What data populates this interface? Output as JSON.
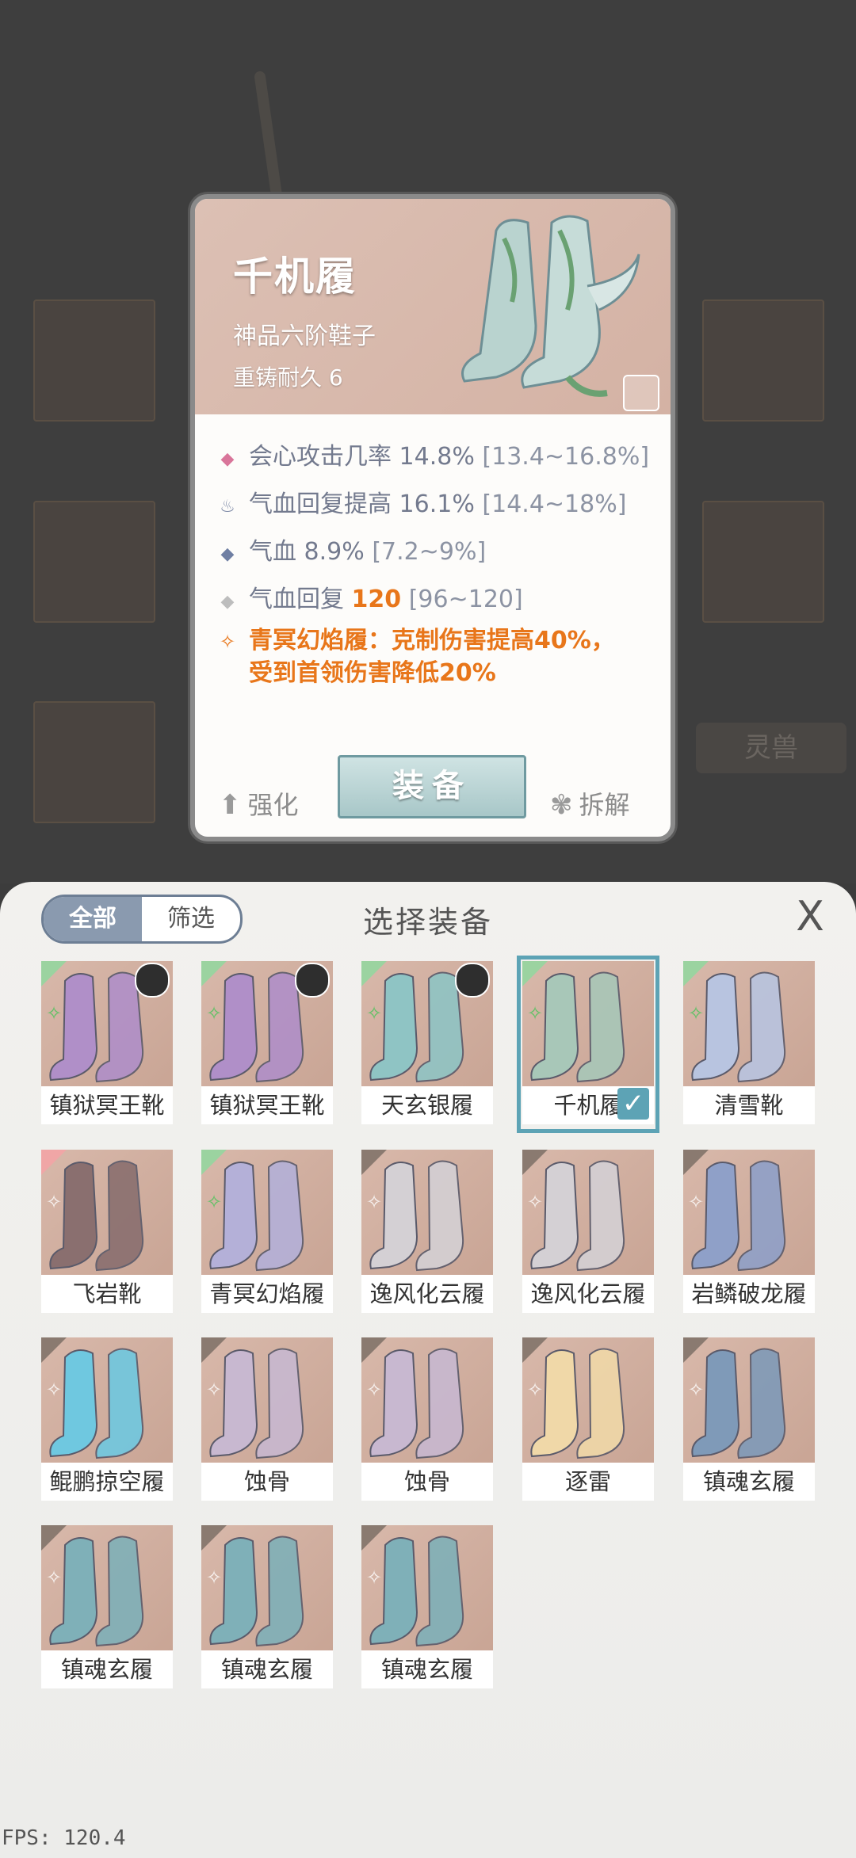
{
  "detail": {
    "name": "千机履",
    "subtitle": "神品六阶鞋子",
    "durability": "重铸耐久 6",
    "stats": [
      {
        "icon": "crit-diamond-icon",
        "glyph": "◆",
        "color": "#d9759a",
        "label": "会心攻击几率",
        "value": "14.8%",
        "range": "[13.4~16.8%]",
        "highlight": false
      },
      {
        "icon": "hp-regen-flame-icon",
        "glyph": "♨",
        "color": "#7b87a5",
        "label": "气血回复提高",
        "value": "16.1%",
        "range": "[14.4~18%]",
        "highlight": false
      },
      {
        "icon": "hp-diamond-icon",
        "glyph": "◆",
        "color": "#6f7fa3",
        "label": "气血",
        "value": "8.9%",
        "range": "[7.2~9%]",
        "highlight": false
      },
      {
        "icon": "hp-regen-diamond-icon",
        "glyph": "◆",
        "color": "#bdbdbd",
        "label": "气血回复",
        "value": "120",
        "range": "[96~120]",
        "highlight": true
      }
    ],
    "special": {
      "line1": "青冥幻焰履：克制伤害提高40%，",
      "line2": "受到首领伤害降低20%"
    },
    "actions": {
      "enhance": "强化",
      "equip": "装备",
      "disassemble": "拆解"
    }
  },
  "background": {
    "tag": "灵兽"
  },
  "panel": {
    "title": "选择装备",
    "tab_all": "全部",
    "tab_filter": "筛选",
    "close": "X",
    "items": [
      {
        "name": "镇狱冥王靴",
        "tone": "#b08fc8",
        "owner": true,
        "mark": "green"
      },
      {
        "name": "镇狱冥王靴",
        "tone": "#b08fc8",
        "owner": true,
        "mark": "green"
      },
      {
        "name": "天玄银履",
        "tone": "#8fc4c4",
        "owner": true,
        "mark": "green"
      },
      {
        "name": "千机履",
        "tone": "#a8c7b8",
        "owner": false,
        "mark": "green",
        "selected": true
      },
      {
        "name": "清雪靴",
        "tone": "#b8c4e0",
        "owner": false,
        "mark": "green"
      },
      {
        "name": "飞岩靴",
        "tone": "#8a6f6f",
        "owner": false,
        "mark": "red"
      },
      {
        "name": "青冥幻焰履",
        "tone": "#b4b0d8",
        "owner": false,
        "mark": "green"
      },
      {
        "name": "逸风化云履",
        "tone": "#d4d0d4",
        "owner": false,
        "mark": "plain"
      },
      {
        "name": "逸风化云履",
        "tone": "#d4d0d4",
        "owner": false,
        "mark": "plain"
      },
      {
        "name": "岩鳞破龙履",
        "tone": "#8fa0c8",
        "owner": false,
        "mark": "plain"
      },
      {
        "name": "鲲鹏掠空履",
        "tone": "#6fc8e0",
        "owner": false,
        "mark": "plain"
      },
      {
        "name": "蚀骨",
        "tone": "#c8b8d0",
        "owner": false,
        "mark": "plain"
      },
      {
        "name": "蚀骨",
        "tone": "#c8b8d0",
        "owner": false,
        "mark": "plain"
      },
      {
        "name": "逐雷",
        "tone": "#f0d8a8",
        "owner": false,
        "mark": "plain"
      },
      {
        "name": "镇魂玄履",
        "tone": "#7f9ab8",
        "owner": false,
        "mark": "plain"
      },
      {
        "name": "镇魂玄履",
        "tone": "#7fb0b8",
        "owner": false,
        "mark": "plain"
      },
      {
        "name": "镇魂玄履",
        "tone": "#7fb0b8",
        "owner": false,
        "mark": "plain"
      },
      {
        "name": "镇魂玄履",
        "tone": "#7fb0b8",
        "owner": false,
        "mark": "plain"
      }
    ]
  },
  "fps": "FPS: 120.4"
}
